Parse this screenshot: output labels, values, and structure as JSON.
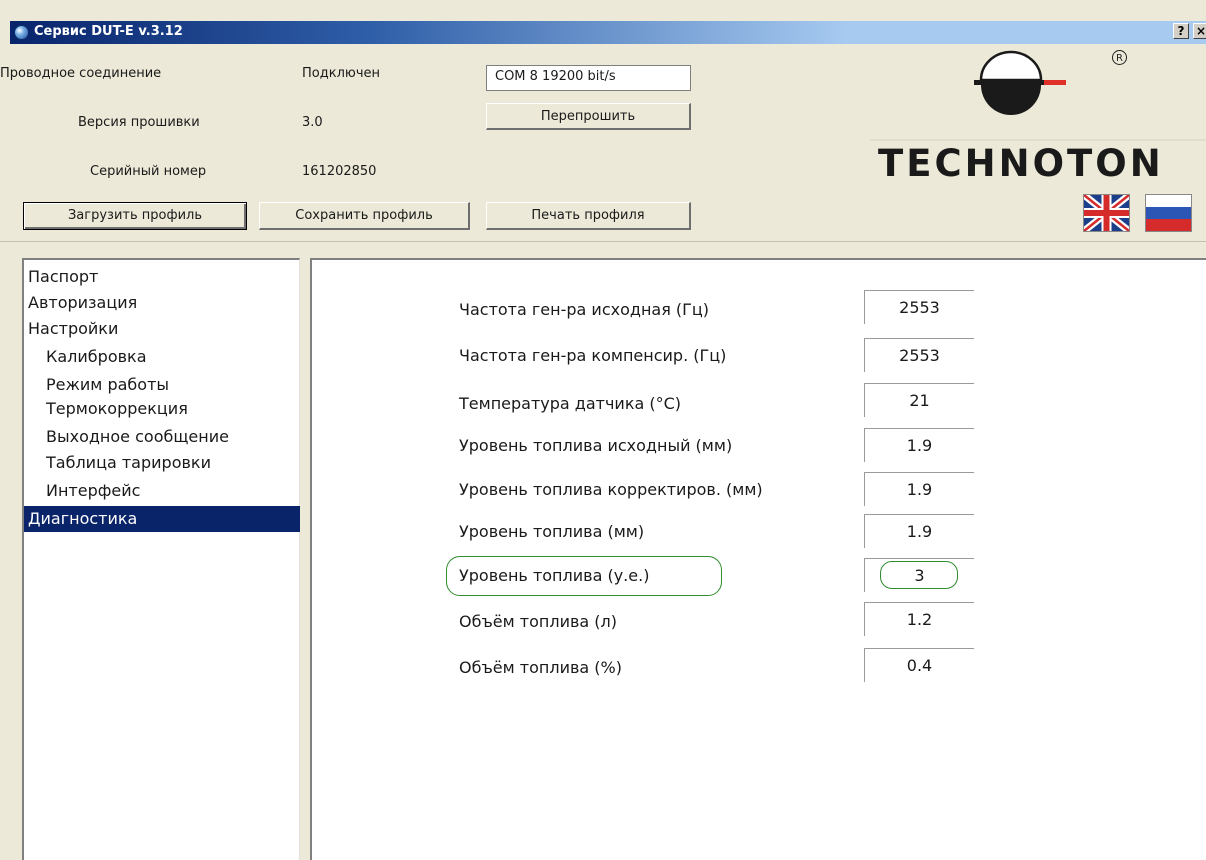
{
  "window": {
    "title": "Сервис DUT-E  v.3.12",
    "help_button": "?",
    "close_button": "×"
  },
  "connection": {
    "label": "Проводное соединение",
    "status": "Подключен",
    "port": "COM 8     19200 bit/s"
  },
  "firmware": {
    "label": "Версия прошивки",
    "value": "3.0",
    "reflash_button": "Перепрошить"
  },
  "serial": {
    "label": "Серийный номер",
    "value": "161202850"
  },
  "toolbar": {
    "load_profile": "Загрузить профиль",
    "save_profile": "Сохранить профиль",
    "print_profile": "Печать профиля"
  },
  "logo": {
    "brand": "TECHNOTON",
    "registered": "R"
  },
  "languages": {
    "english": "english-flag-icon",
    "russian": "russian-flag-icon"
  },
  "nav": {
    "items": [
      {
        "label": "Паспорт",
        "level": 1
      },
      {
        "label": "Авторизация",
        "level": 1
      },
      {
        "label": "Настройки",
        "level": 1
      },
      {
        "label": "Калибровка",
        "level": 2
      },
      {
        "label": "Режим работы",
        "level": 2
      },
      {
        "label": "Термокоррекция",
        "level": 2
      },
      {
        "label": "Выходное сообщение",
        "level": 2
      },
      {
        "label": "Таблица тарировки",
        "level": 2
      },
      {
        "label": "Интерфейс",
        "level": 2
      },
      {
        "label": "Диагностика",
        "level": 1,
        "selected": true
      }
    ]
  },
  "diagnostics": {
    "rows": [
      {
        "label": "Частота ген-ра исходная (Гц)",
        "value": "2553"
      },
      {
        "label": "Частота ген-ра компенсир. (Гц)",
        "value": "2553"
      },
      {
        "label": "Температура датчика (°C)",
        "value": "21"
      },
      {
        "label": "Уровень топлива исходный (мм)",
        "value": "1.9"
      },
      {
        "label": "Уровень топлива корректиров. (мм)",
        "value": "1.9"
      },
      {
        "label": "Уровень топлива (мм)",
        "value": "1.9"
      },
      {
        "label": "Уровень топлива (у.е.)",
        "value": "3"
      },
      {
        "label": "Объём топлива (л)",
        "value": "1.2"
      },
      {
        "label": "Объём топлива (%)",
        "value": "0.4"
      }
    ],
    "highlight_color": "#2e8b2e"
  },
  "colors": {
    "titlebar_start": "#08246b",
    "titlebar_end": "#a6caf0",
    "selection": "#0a246a",
    "logo_accent": "#e0302a"
  }
}
